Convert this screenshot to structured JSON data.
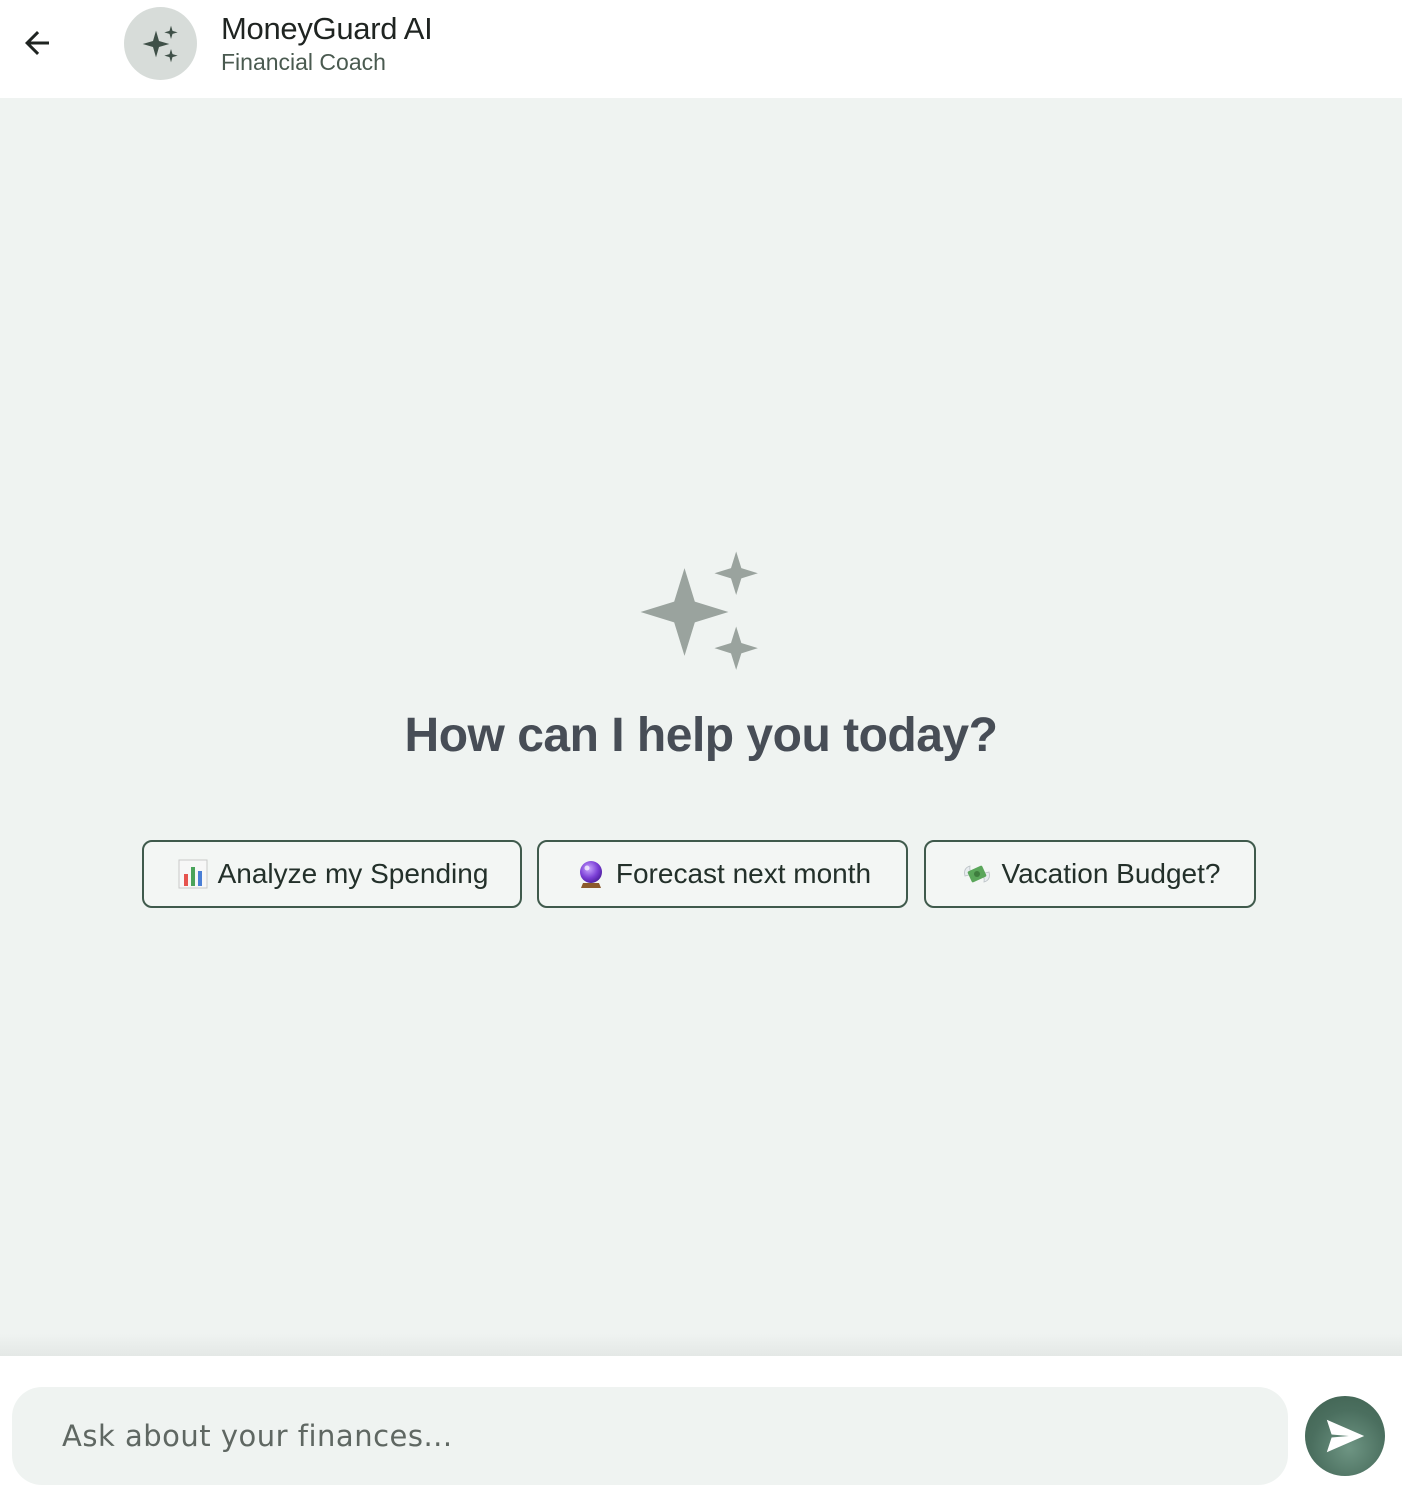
{
  "header": {
    "back_icon": "arrow-left-icon",
    "avatar_icon": "sparkles-icon",
    "title": "MoneyGuard AI",
    "subtitle": "Financial Coach"
  },
  "main": {
    "hero_icon": "sparkles-icon",
    "hero_title": "How can I help you today?",
    "suggestions": [
      {
        "icon": "bar-chart-emoji",
        "label": "Analyze my Spending"
      },
      {
        "icon": "crystal-ball-emoji",
        "label": "Forecast next month"
      },
      {
        "icon": "money-with-wings-emoji",
        "label": "Vacation Budget?"
      }
    ]
  },
  "footer": {
    "input_placeholder": "Ask about your finances...",
    "input_value": "",
    "send_icon": "send-icon"
  },
  "colors": {
    "accent": "#4b6f5f",
    "background": "#eff3f1",
    "hero_icon": "#9aa39e",
    "title_text": "#474d56"
  }
}
